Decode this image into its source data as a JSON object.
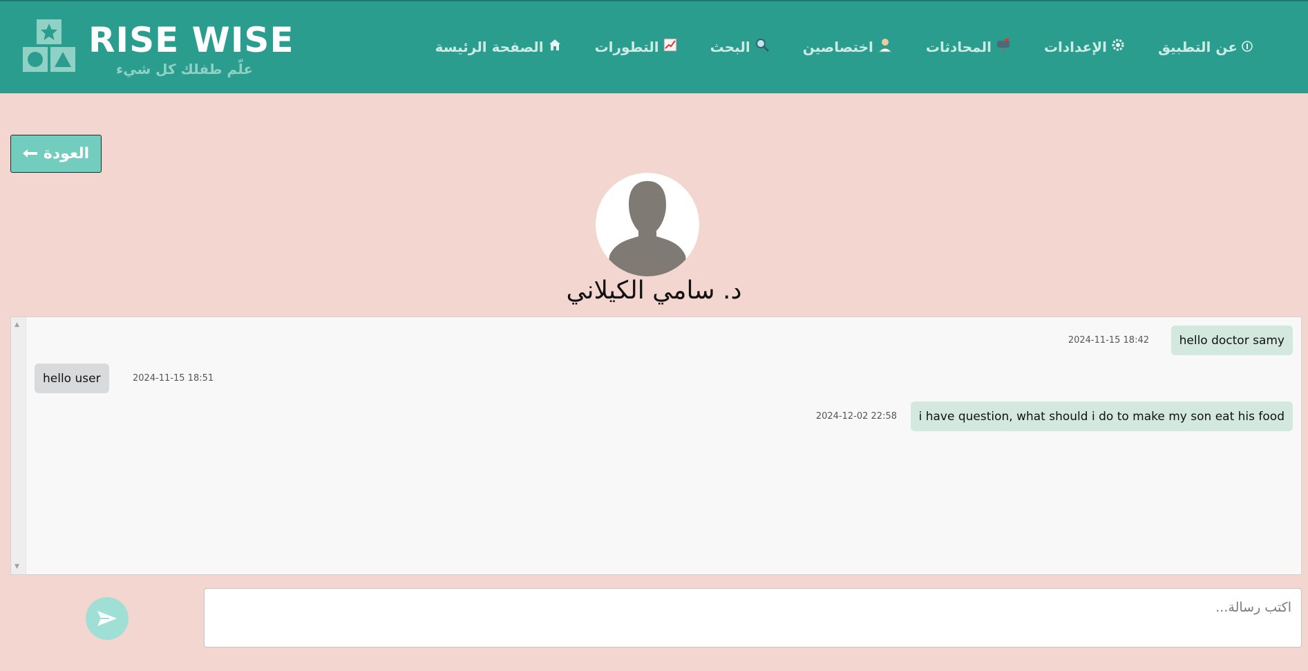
{
  "brand": {
    "title": "RISE WISE",
    "subtitle": "علّم طفلك كل شيء",
    "color": "#2b9d8e",
    "accent": "#8fd1c5"
  },
  "nav": {
    "items": [
      {
        "label": "الصفحة الرئيسة",
        "icon": "home-icon"
      },
      {
        "label": "التطورات",
        "icon": "chart-icon"
      },
      {
        "label": "البحث",
        "icon": "search-icon"
      },
      {
        "label": "اختصاصين",
        "icon": "doctor-icon"
      },
      {
        "label": "المحادثات",
        "icon": "mailbox-icon"
      },
      {
        "label": "الإعدادات",
        "icon": "gear-icon"
      },
      {
        "label": "عن التطبيق",
        "icon": "info-icon"
      }
    ]
  },
  "back_button": {
    "label": "العودة",
    "icon": "arrow-left-icon"
  },
  "doctor": {
    "name": "د. سامي الكيلاني",
    "avatar": "person-silhouette-icon"
  },
  "messages": [
    {
      "direction": "sent",
      "text": "hello doctor samy",
      "timestamp": "2024-11-15 18:42"
    },
    {
      "direction": "received",
      "text": "hello user",
      "timestamp": "2024-11-15 18:51"
    },
    {
      "direction": "sent",
      "text": "i have question, what should i do to make my son eat his food",
      "timestamp": "2024-12-02 22:58"
    }
  ],
  "composer": {
    "placeholder": "اكتب رسالة...",
    "value": "",
    "send_icon": "send-icon"
  },
  "colors": {
    "background": "#f3d6cf",
    "sent_bubble": "#d3e9e0",
    "received_bubble": "#d9dadb",
    "back_button": "#72cdbf",
    "send_button": "#9fdfd6"
  }
}
